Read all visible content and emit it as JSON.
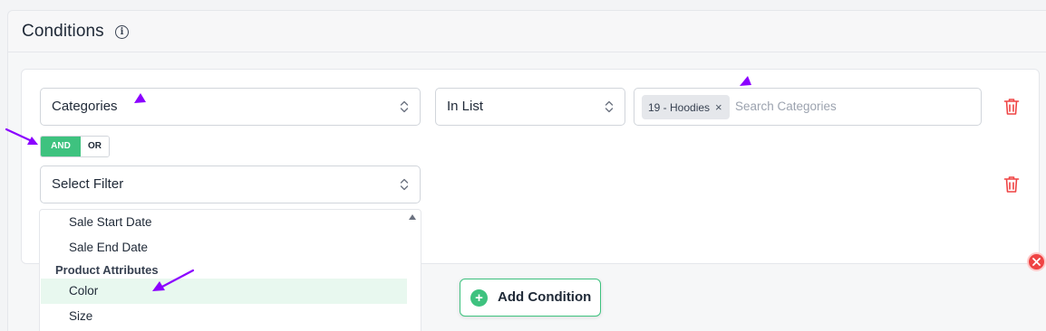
{
  "panel": {
    "title": "Conditions",
    "info_icon": "i"
  },
  "rows": [
    {
      "filter": "Categories",
      "operator": "In List",
      "tag": "19 - Hoodies",
      "tag_remove": "×",
      "search_placeholder": "Search Categories"
    },
    {
      "filter": "Select Filter"
    }
  ],
  "logic": {
    "and_label": "AND",
    "or_label": "OR",
    "selected": "AND"
  },
  "dropdown": {
    "items": [
      "Sale Start Date",
      "Sale End Date"
    ],
    "group_label": "Product Attributes",
    "group_items": [
      "Color",
      "Size"
    ],
    "highlighted": "Color"
  },
  "add_button": {
    "label": "Add Condition",
    "icon": "+"
  },
  "icons": {
    "trash": "trash-icon",
    "chevron": "chevron-updown-icon",
    "close": "close-circle-icon"
  },
  "colors": {
    "accent_green": "#3ec27f",
    "danger_red": "#ef4444",
    "annotation_purple": "#8b00ff",
    "highlight_bg": "#e8f8ef"
  }
}
